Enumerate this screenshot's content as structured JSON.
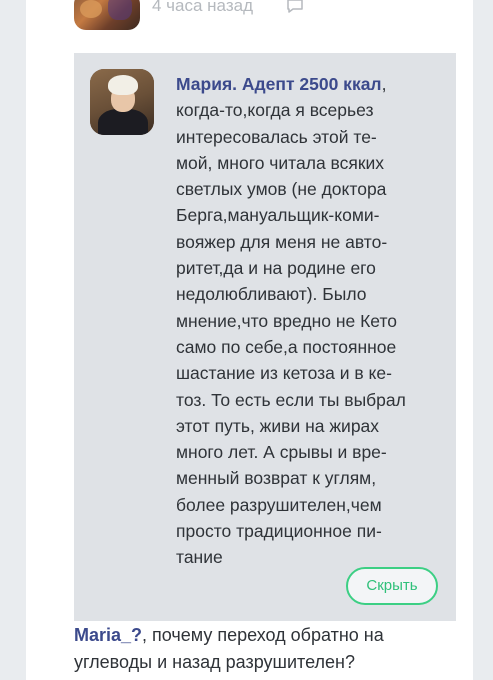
{
  "previous_comment": {
    "timestamp": "4 часа назад",
    "reply_icon": "speech-bubble-icon"
  },
  "reply": {
    "author": "Мария. Адепт 2500 ккал",
    "author_suffix": ",",
    "lines": [
      "когда-то,когда я всерьез",
      "интересовалась этой те-",
      "мой, много читала всяких",
      "светлых умов (не доктора",
      "Берга,мануальщик-коми-",
      "вояжер для меня не авто-",
      "ритет,да и на родине его",
      "недолюбливают). Было",
      "мнение,что вредно не Кето",
      "само по себе,а постоянное",
      "шастание из кетоза и в ке-",
      "тоз. То есть если ты выбрал",
      "этот путь, живи на жирах",
      "много лет. А срывы и вре-",
      "менный возврат к углям,",
      "более разрушителен,чем",
      "просто традиционное пи-",
      "тание"
    ],
    "hide_button_label": "Скрыть"
  },
  "followup": {
    "mention": "Maria_?",
    "text_line1": ", почему переход обратно на",
    "text_line2": "углеводы и назад разрушителен?"
  },
  "colors": {
    "accent_green": "#3ccf84",
    "author_blue": "#3c4a8c",
    "card_bg": "#dfe2e6"
  }
}
